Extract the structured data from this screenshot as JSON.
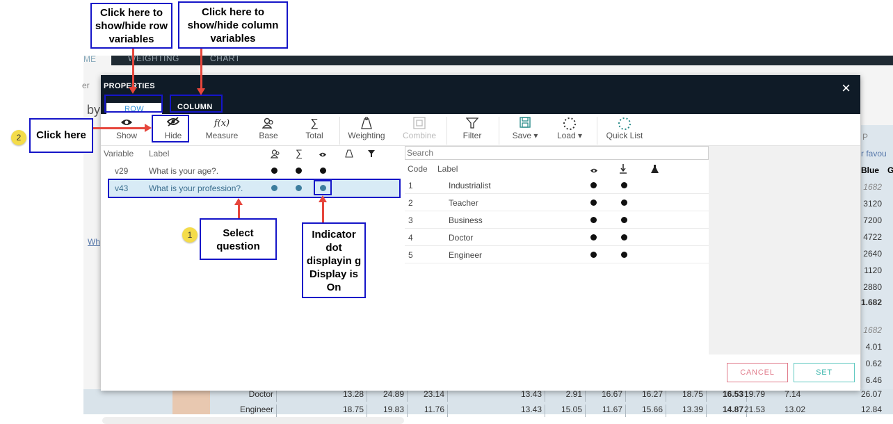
{
  "background": {
    "tabs": [
      "WEIGHTING",
      "CHART"
    ],
    "left_fragments": [
      "ME",
      "er",
      "by",
      "Wh"
    ],
    "right_header": [
      "P",
      "r favou",
      "Blue",
      "G"
    ],
    "right_values": [
      "1682",
      "3120",
      "7200",
      "4722",
      "2640",
      "1120",
      "2880",
      "1.682",
      "1682",
      "4.01",
      "0.62",
      "6.46",
      "26.07",
      "12.84"
    ],
    "table_rows": [
      {
        "label": "Doctor",
        "values": [
          "13.28",
          "24.89",
          "23.14",
          "13.43",
          "2.91",
          "16.67",
          "16.27",
          "18.75",
          "16.53",
          "19.79",
          "7.14"
        ]
      },
      {
        "label": "Engineer",
        "values": [
          "18.75",
          "19.83",
          "11.76",
          "13.43",
          "15.05",
          "11.67",
          "15.66",
          "13.39",
          "14.87",
          "21.53",
          "13.02"
        ]
      }
    ]
  },
  "dialog": {
    "title": "PROPERTIES",
    "close_symbol": "×",
    "tabs": {
      "row": "ROW",
      "column": "COLUMN"
    },
    "toolbar": [
      {
        "label": "Show",
        "icon": "eye-icon",
        "glyph": "👁",
        "disabled": false
      },
      {
        "label": "Hide",
        "icon": "eye-slash-icon",
        "glyph": "◉",
        "disabled": false
      },
      {
        "label": "Measure",
        "icon": "function-icon",
        "glyph": "f(x)",
        "disabled": false
      },
      {
        "label": "Base",
        "icon": "base-users-icon",
        "glyph": "⚇",
        "disabled": false
      },
      {
        "label": "Total",
        "icon": "sigma-icon",
        "glyph": "∑",
        "disabled": false
      },
      {
        "label": "Weighting",
        "icon": "weight-icon",
        "glyph": "⏏",
        "disabled": false
      },
      {
        "label": "Combine",
        "icon": "combine-icon",
        "glyph": "⧉",
        "disabled": true
      },
      {
        "label": "Filter",
        "icon": "filter-icon",
        "glyph": "⏷",
        "disabled": false
      },
      {
        "label": "Save ▾",
        "icon": "save-icon",
        "glyph": "🖫",
        "disabled": false
      },
      {
        "label": "Load ▾",
        "icon": "load-icon",
        "glyph": "◌",
        "disabled": false
      },
      {
        "label": "Quick List",
        "icon": "quick-list-icon",
        "glyph": "◌",
        "disabled": false
      }
    ],
    "variables": {
      "headers": {
        "variable": "Variable",
        "label": "Label"
      },
      "header_icons": [
        "base-users-icon",
        "sigma-icon",
        "eye-icon",
        "weight-icon",
        "filter-icon"
      ],
      "rows": [
        {
          "id": "v29",
          "label": "What is your age?.",
          "selected": false
        },
        {
          "id": "v43",
          "label": "What is your profession?.",
          "selected": true
        }
      ]
    },
    "codes": {
      "search_placeholder": "Search",
      "headers": {
        "code": "Code",
        "label": "Label"
      },
      "header_icons": [
        "eye-icon",
        "download-icon",
        "flask-icon"
      ],
      "rows": [
        {
          "code": "1",
          "label": "Industrialist"
        },
        {
          "code": "2",
          "label": "Teacher"
        },
        {
          "code": "3",
          "label": "Business"
        },
        {
          "code": "4",
          "label": "Doctor"
        },
        {
          "code": "5",
          "label": "Engineer"
        }
      ]
    },
    "buttons": {
      "cancel": "CANCEL",
      "set": "SET"
    }
  },
  "annotations": {
    "row_callout": "Click here to show/hide row variables",
    "column_callout": "Click here to show/hide column variables",
    "click_here": "Click here",
    "select_question": "Select question",
    "indicator": "Indicator dot displayin g  Display is On",
    "badge1": "1",
    "badge2": "2"
  }
}
